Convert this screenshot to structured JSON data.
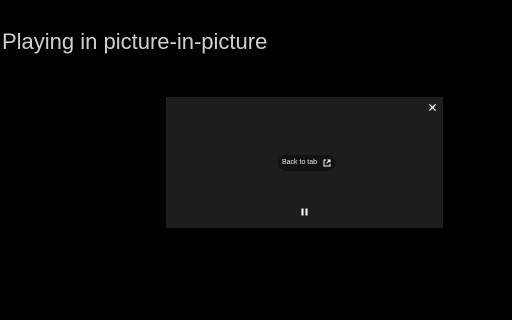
{
  "page": {
    "title": "Playing in picture-in-picture",
    "background_color": "#000000",
    "title_color": "#cfcfcf"
  },
  "pip_window": {
    "background_color": "#1c1d1f",
    "close_icon": "close-icon",
    "back_to_tab": {
      "label": "Back to tab",
      "icon": "open-in-new-icon"
    },
    "pause_icon": "pause-icon"
  }
}
